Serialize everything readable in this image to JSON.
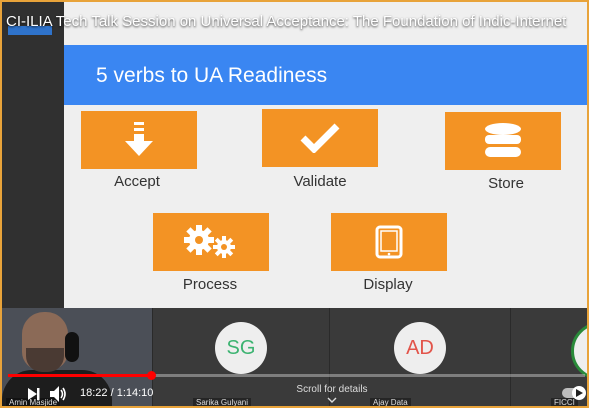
{
  "video": {
    "title": "CI-ILIA Tech Talk Session on Universal Acceptance: The Foundation of Indic-Internet",
    "current_time": "18:22",
    "duration": "1:14:10",
    "time_display": "18:22 / 1:14:10",
    "progress_fraction": 0.248,
    "scroll_hint": "Scroll for details",
    "accent_color": "#ff0000",
    "border_color": "#e8a33a"
  },
  "slide": {
    "title": "5 verbs to UA Readiness",
    "header_color": "#3a86f2",
    "tile_color": "#f39324",
    "verbs": [
      {
        "label": "Accept",
        "icon": "download-arrow-icon"
      },
      {
        "label": "Validate",
        "icon": "checkmark-icon"
      },
      {
        "label": "Store",
        "icon": "database-icon"
      },
      {
        "label": "Process",
        "icon": "gears-icon"
      },
      {
        "label": "Display",
        "icon": "tablet-icon"
      }
    ]
  },
  "participants": [
    {
      "name": "Amin Masjide",
      "initials": "",
      "type": "video"
    },
    {
      "name": "Sarika Gulyani",
      "initials": "SG",
      "color": "#3cb371"
    },
    {
      "name": "Ajay Data",
      "initials": "AD",
      "color": "#e2544a"
    },
    {
      "name": "FICCI",
      "initials": "F",
      "color": "#222222"
    }
  ]
}
